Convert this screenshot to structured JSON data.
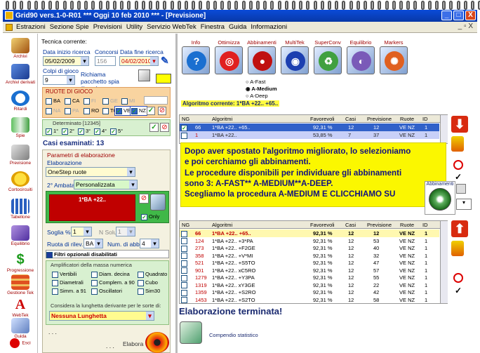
{
  "window": {
    "title": "Grid90 vers.1-0-R01   ***  Oggi 10 feb 2010   ***  - [Previsione]",
    "controls": [
      "_",
      "□",
      "X"
    ]
  },
  "menu": [
    "Estrazioni",
    "Sezione Spie",
    "Previsioni",
    "Utility",
    "Servizio WebTek",
    "Finestra",
    "Guida",
    "Informazioni"
  ],
  "mdi_controls": "_ ▫ X",
  "nav": [
    "Archivi",
    "Archivi derivati",
    "Ritardi",
    "Spie",
    "Previsione",
    "Cortocircuiti",
    "Tabellone",
    "Equilibrio",
    "Progressione",
    "Gestione Tek",
    "WebTek",
    "Guida",
    "Esci"
  ],
  "tecnica": {
    "label": "Tecnica corrente:",
    "data_inizio_label": "Data inizio ricerca",
    "data_inizio": "05/02/2009",
    "concorsi_label": "Concorsi",
    "concorsi": "156",
    "data_fine_label": "Data fine ricerca",
    "data_fine": "04/02/2010",
    "colpi_label": "Colpi di gioco",
    "colpi": "9",
    "richiama_label": "Richiama pacchetto spia (*.pcs)"
  },
  "ruote": {
    "title": "RUOTE DI GIOCO",
    "row1": [
      "BA",
      "CA",
      "FI",
      "GE",
      "MI"
    ],
    "row2": [
      "NA",
      "PA",
      "RO",
      "TO",
      "VE",
      "NZ"
    ],
    "checked": [
      "VE",
      "NZ"
    ]
  },
  "determinato": {
    "label": "Determinato [12345]",
    "items": [
      "1°",
      "2°",
      "3°",
      "4°",
      "5°"
    ]
  },
  "casi": "Casi esaminati: 13",
  "parametri": {
    "title": "Parametri di elaborazione",
    "elaborazione_label": "Elaborazione",
    "elaborazione": "OneStep ruote",
    "ambata_label": "2° Ambata",
    "ambata": "Personalizzata",
    "red_value": "1*BA +22..",
    "only_label": "Only",
    "soglia_label": "Soglia %",
    "soglia": "1",
    "nsoluz_label": "N Soluz.",
    "nsoluz": "1",
    "ruota_label": "Ruota di rilev.",
    "ruota": "BA",
    "numabb_label": "Num. di abb.",
    "numabb": "4",
    "filtri_label": "Filtri opzionali disabilitati",
    "ampl_label": "Amplificatori della massa numerica",
    "ampl_items": [
      "Vertibili",
      "Diam. decina",
      "Quadrato",
      "Diametrali",
      "Complem. a 90",
      "Cubo",
      "Simm. a 91",
      "Oscillatori",
      "Sim30"
    ],
    "lunghetta_label": "Considera la lunghetta derivante per le sorte di:",
    "lunghetta": "Nessuna Lunghetta"
  },
  "bottom_left": {
    "dots1": ". . .",
    "dots2": ". . .",
    "elabora": "Elabora"
  },
  "toolbar": [
    {
      "label": "Info",
      "color": "#1a6fd0",
      "glyph": "?"
    },
    {
      "label": "Ottimizza",
      "color": "#e02020",
      "glyph": "◎"
    },
    {
      "label": "Abbinamenti",
      "color": "#c01010",
      "glyph": "●"
    },
    {
      "label": "MultiTek",
      "color": "#1c3fb0",
      "glyph": "◉"
    },
    {
      "label": "SuperConv",
      "color": "#40a040",
      "glyph": "♻"
    },
    {
      "label": "Equilibrio",
      "color": "#7a5ab8",
      "glyph": "◐"
    },
    {
      "label": "Markers",
      "color": "#e06020",
      "glyph": "✺"
    }
  ],
  "modes": {
    "items": [
      "A-Fast",
      "A-Medium",
      "A-Deep"
    ],
    "selected": "A-Medium",
    "algoritmo_corrente": "Algoritmo corrente: 1*BA +22.. +65.."
  },
  "table1": {
    "headers": [
      "NG",
      "Algoritmi",
      "Favorevoli",
      "Casi",
      "Previsione",
      "Ruote",
      "ID"
    ],
    "rows": [
      [
        "66",
        "1*BA +22.. +65..",
        "92,31 %",
        "12",
        "12",
        "VE NZ",
        "1"
      ],
      [
        "1",
        "1*BA +22..",
        "53,85 %",
        "7",
        "37",
        "VE NZ",
        "1"
      ]
    ]
  },
  "overlay": {
    "lines": [
      "Dopo aver spostato l'algoritmo migliorato, lo selezioniamo",
      "e poi cerchiamo gli abbinamenti.",
      "Le procedure disponibili per individuare gli abbinamenti",
      "sono 3: A-FAST** A-MEDIUM**A-DEEP.",
      "Scegliamo la procedura A-MEDIUM E CLICCHIAMO SU"
    ],
    "tooltip": "Abbinamenti"
  },
  "table2": {
    "headers": [
      "NG",
      "Algoritmi",
      "Favorevoli",
      "Casi",
      "Previsione",
      "Ruote",
      "ID"
    ],
    "rows": [
      [
        "66",
        "1*BA +22.. +65..",
        "92,31 %",
        "12",
        "12",
        "VE NZ",
        "1"
      ],
      [
        "124",
        "1*BA +22.. +3*PA",
        "92,31 %",
        "12",
        "53",
        "VE NZ",
        "1"
      ],
      [
        "273",
        "1*BA +22.. +F2GE",
        "92,31 %",
        "12",
        "40",
        "VE NZ",
        "1"
      ],
      [
        "358",
        "1*BA +22.. +V*MI",
        "92,31 %",
        "12",
        "32",
        "VE NZ",
        "1"
      ],
      [
        "521",
        "1*BA +22.. +S5TO",
        "92,31 %",
        "12",
        "47",
        "VE NZ",
        "1"
      ],
      [
        "901",
        "1*BA +22.. xC5RO",
        "92,31 %",
        "12",
        "57",
        "VE NZ",
        "1"
      ],
      [
        "1279",
        "1*BA +22.. +Y3PA",
        "92,31 %",
        "12",
        "55",
        "VE NZ",
        "1"
      ],
      [
        "1319",
        "1*BA +22.. xY3GE",
        "92,31 %",
        "12",
        "22",
        "VE NZ",
        "1"
      ],
      [
        "1359",
        "1*BA +22.. +S2RO",
        "92,31 %",
        "12",
        "42",
        "VE NZ",
        "1"
      ],
      [
        "1453",
        "1*BA +22.. +S2TO",
        "92,31 %",
        "12",
        "58",
        "VE NZ",
        "1"
      ]
    ]
  },
  "status": "Elaborazione terminata!",
  "compendio": "Compendio statistico"
}
